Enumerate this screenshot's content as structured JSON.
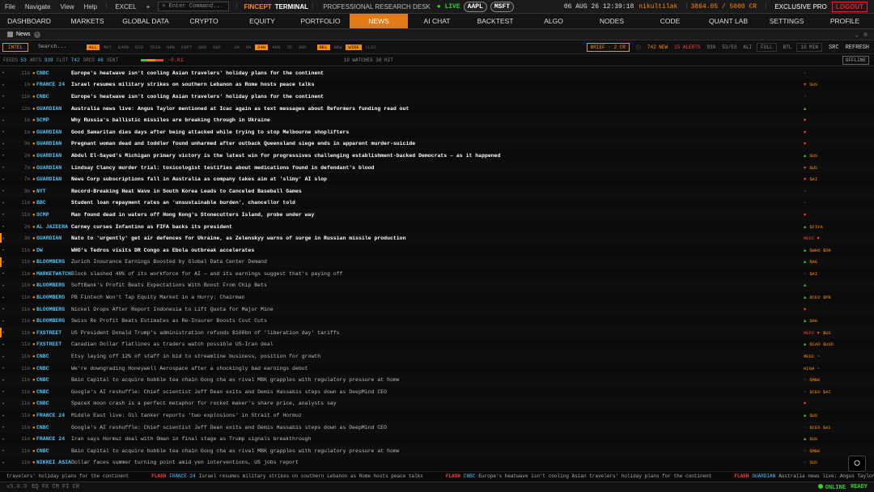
{
  "menu": {
    "items": [
      "File",
      "Navigate",
      "View",
      "Help"
    ],
    "excel": "EXCEL",
    "plus": "+",
    "command_placeholder": "> Enter Command..."
  },
  "brand": {
    "part1": "FINCEPT",
    "part2": "TERMINAL",
    "desk": "PROFESSIONAL RESEARCH DESK"
  },
  "status": {
    "live": "LIVE",
    "tickers": [
      "AAPL",
      "MSFT"
    ],
    "datetime": "06 AUG 26 12:39:18",
    "user": "nikultilak",
    "credits": "3864.05 / 5000 CR",
    "plan": "EXCLUSIVE PRO",
    "logout": "LOGOUT"
  },
  "nav": [
    "DASHBOARD",
    "MARKETS",
    "GLOBAL DATA",
    "CRYPTO",
    "EQUITY",
    "PORTFOLIO",
    "NEWS",
    "AI CHAT",
    "BACKTEST",
    "ALGO",
    "NODES",
    "CODE",
    "QUANT LAB",
    "SETTINGS",
    "PROFILE"
  ],
  "nav_active": "NEWS",
  "subtab": {
    "name": "News",
    "close": "×"
  },
  "filters": {
    "intel": "INTEL",
    "search_placeholder": "Search...",
    "categories": [
      "ALL",
      "MKT",
      "EARN",
      "ECO",
      "TECH",
      "NRG",
      "CRPT",
      "GEO",
      "DEF"
    ],
    "active_category": "ALL",
    "times": [
      "1H",
      "6H",
      "24H",
      "48H",
      "7D",
      "30D"
    ],
    "active_time": "24H",
    "sorts": [
      "REL",
      "NEW",
      "WIRE",
      "CLST"
    ],
    "active_sorts": [
      "REL",
      "WIRE"
    ],
    "brief": "BRIEF · 2 CR",
    "new_count": "742 NEW",
    "alerts": "15 ALERTS",
    "count": "939",
    "ratio": "53/53",
    "ali": "ALI",
    "full": "FULL",
    "btl": "BTL",
    "interval": "10 MIN",
    "src": "SRC",
    "refresh": "REFRESH"
  },
  "stats": {
    "feeds_label": "FEEDS",
    "feeds": "53",
    "arts_label": "ARTS",
    "arts": "939",
    "clst_label": "CLST",
    "clst": "742",
    "srcs_label": "SRCS",
    "srcs": "48",
    "sent_label": "SENT",
    "sentiment": "-0.01",
    "watches": "10 WATCHES",
    "hit": "38 HIT",
    "offline": "OFFLINE"
  },
  "colors": {
    "accent": "#ff8c00",
    "source": "#4fc3f7",
    "up": "#2fd12f",
    "down": "#ff3b3b"
  },
  "news": [
    {
      "age": "11m",
      "src": "CNBC",
      "headline": "Europe's heatwave isn't cooling Asian travelers' holiday plans for the continent",
      "bold": true,
      "sig": "~",
      "tags": "",
      "bar": ""
    },
    {
      "age": "1m",
      "src": "FRANCE 24",
      "headline": "Israel resumes military strikes on southern Lebanon as Rome hosts peace talks",
      "bold": true,
      "sig": "▼",
      "tags": "$US",
      "bar": ""
    },
    {
      "age": "11m",
      "src": "CNBC",
      "headline": "Europe's heatwave isn't cooling Asian travelers' holiday plans for the continent",
      "bold": true,
      "sig": "~",
      "tags": "",
      "bar": ""
    },
    {
      "age": "12m",
      "src": "GUARDIAN",
      "headline": "Australia news live: Angus Taylor mentioned at Icac again as text messages about Reformers funding read out",
      "bold": true,
      "sig": "▲",
      "tags": "",
      "bar": ""
    },
    {
      "age": "1m",
      "src": "SCMP",
      "headline": "Why Russia's ballistic missiles are breaking through in Ukraine",
      "bold": true,
      "sig": "▼",
      "tags": "",
      "bar": ""
    },
    {
      "age": "1m",
      "src": "GUARDIAN",
      "headline": "Good Samaritan dies days after being attacked while trying to stop Melbourne shoplifters",
      "bold": true,
      "sig": "▼",
      "tags": "",
      "bar": ""
    },
    {
      "age": "9m",
      "src": "GUARDIAN",
      "headline": "Pregnant woman dead and toddler found unharmed after outback Queensland siege ends in apparent murder-suicide",
      "bold": true,
      "sig": "▼",
      "tags": "",
      "bar": ""
    },
    {
      "age": "2m",
      "src": "GUARDIAN",
      "headline": "Abdul El-Sayed's Michigan primary victory is the latest win for progressives challenging establishment-backed Democrats – as it happened",
      "bold": true,
      "sig": "▲",
      "tags": "$US",
      "bar": ""
    },
    {
      "age": "7m",
      "src": "GUARDIAN",
      "headline": "Lindsay Clancy murder trial: toxicologist testifies about medications found in defendant's blood",
      "bold": true,
      "sig": "▼",
      "tags": "$US",
      "bar": ""
    },
    {
      "age": "7m",
      "src": "GUARDIAN",
      "headline": "News Corp subscriptions fall in Australia as company takes aim at 'slimy' AI slop",
      "bold": true,
      "sig": "▼",
      "tags": "$AI",
      "bar": ""
    },
    {
      "age": "9m",
      "src": "NYT",
      "headline": "Record-Breaking Heat Wave in South Korea Leads to Canceled Baseball Games",
      "bold": true,
      "sig": "~",
      "tags": "",
      "bar": ""
    },
    {
      "age": "11m",
      "src": "BBC",
      "headline": "Student loan repayment rates an 'unsustainable burden', chancellor told",
      "bold": true,
      "sig": "~",
      "tags": "",
      "bar": ""
    },
    {
      "age": "11m",
      "src": "SCMP",
      "headline": "Man found dead in waters off Hong Kong's Stonecutters Island, probe under way",
      "bold": true,
      "sig": "▼",
      "tags": "",
      "bar": ""
    },
    {
      "age": "2m",
      "src": "AL JAZEERA",
      "headline": "Carney curses Infantino as FIFA backs its president",
      "bold": true,
      "sig": "▲",
      "tags": "$FIFA",
      "bar": ""
    },
    {
      "age": "3m",
      "src": "GUARDIAN",
      "headline": "Nato to 'urgently' get air defences for Ukraine, as Zelenskyy warns of surge in Russian missile production",
      "bold": true,
      "sig": "MEDI ▼",
      "tags": "",
      "bar": "#ff8c00"
    },
    {
      "age": "11m",
      "src": "DW",
      "headline": "WHO's Tedros visits DR Congo as Ebola outbreak accelerates",
      "bold": true,
      "sig": "▲",
      "tags": "$WHO $DR",
      "bar": ""
    },
    {
      "age": "11m",
      "src": "BLOOMBERG",
      "headline": "Zurich Insurance Earnings Boosted by Global Data Center Demand",
      "bold": false,
      "sig": "▲",
      "tags": "$AG",
      "bar": "#ff8c00"
    },
    {
      "age": "11m",
      "src": "MARKETWATCH",
      "headline": "Block slashed 40% of its workforce for AI — and its earnings suggest that's paying off",
      "bold": false,
      "sig": "~",
      "tags": "$AI",
      "bar": ""
    },
    {
      "age": "11m",
      "src": "BLOOMBERG",
      "headline": "SoftBank's Profit Beats Expectations With Boost From Chip Bets",
      "bold": false,
      "sig": "▲",
      "tags": "",
      "bar": ""
    },
    {
      "age": "11m",
      "src": "BLOOMBERG",
      "headline": "PB Fintech Won't Tap Equity Market in a Hurry: Chairman",
      "bold": false,
      "sig": "▲",
      "tags": "$CEO $PB",
      "bar": ""
    },
    {
      "age": "11m",
      "src": "BLOOMBERG",
      "headline": "Nickel Drops After Report Indonesia to Lift Quota for Major Mine",
      "bold": false,
      "sig": "▼",
      "tags": "",
      "bar": ""
    },
    {
      "age": "11m",
      "src": "BLOOMBERG",
      "headline": "Swiss Re Profit Beats Estimates as Re-Insurer Boosts Cost Cuts",
      "bold": false,
      "sig": "▲",
      "tags": "$AG",
      "bar": ""
    },
    {
      "age": "11m",
      "src": "FXSTREET",
      "headline": "US President Donald Trump's administration refunds $100bn of 'liberation day' tariffs",
      "bold": false,
      "sig": "MEDI ▼",
      "tags": "$US",
      "bar": "#ff8c00"
    },
    {
      "age": "11m",
      "src": "FXSTREET",
      "headline": "Canadian Dollar flatlines as traders watch possible US-Iran deal",
      "bold": false,
      "sig": "▲",
      "tags": "$CAD $USD",
      "bar": ""
    },
    {
      "age": "11m",
      "src": "CNBC",
      "headline": "Etsy laying off 12% of staff in bid to streamline business, position for growth",
      "bold": false,
      "sig": "MEDI ~",
      "tags": "",
      "bar": ""
    },
    {
      "age": "11m",
      "src": "CNBC",
      "headline": "We're downgrading Honeywell Aerospace after a shockingly bad earnings debut",
      "bold": false,
      "sig": "HIGH ~",
      "tags": "",
      "bar": ""
    },
    {
      "age": "11m",
      "src": "CNBC",
      "headline": "Bain Capital to acquire bubble tea chain Gong cha as rival MBK grapples with regulatory pressure at home",
      "bold": false,
      "sig": "~",
      "tags": "$MBK",
      "bar": ""
    },
    {
      "age": "11m",
      "src": "CNBC",
      "headline": "Google's AI reshuffle: Chief scientist Jeff Dean exits and Demis Hassabis steps down as DeepMind CEO",
      "bold": false,
      "sig": "~",
      "tags": "$CEO $AI",
      "bar": ""
    },
    {
      "age": "11m",
      "src": "CNBC",
      "headline": "SpaceX moon crash is a perfect metaphor for rocket maker's share price, analysts say",
      "bold": false,
      "sig": "▼",
      "tags": "",
      "bar": ""
    },
    {
      "age": "11m",
      "src": "FRANCE 24",
      "headline": "Middle East live: Oil tanker reports 'two explosions' in Strait of Hormuz",
      "bold": false,
      "sig": "▲",
      "tags": "$US",
      "bar": ""
    },
    {
      "age": "11m",
      "src": "CNBC",
      "headline": "Google's AI reshuffle: Chief scientist Jeff Dean exits and Demis Hassabis steps down as DeepMind CEO",
      "bold": false,
      "sig": "~",
      "tags": "$CEO $AI",
      "bar": ""
    },
    {
      "age": "11m",
      "src": "FRANCE 24",
      "headline": "Iran says Hormuz deal with Oman in final stage as Trump signals breakthrough",
      "bold": false,
      "sig": "▲",
      "tags": "$US",
      "bar": ""
    },
    {
      "age": "11m",
      "src": "CNBC",
      "headline": "Bain Capital to acquire bubble tea chain Gong cha as rival MBK grapples with regulatory pressure at home",
      "bold": false,
      "sig": "~",
      "tags": "$MBK",
      "bar": ""
    },
    {
      "age": "11m",
      "src": "NIKKEI ASIA",
      "headline": "Dollar faces summer turning point amid yen interventions, US jobs report",
      "bold": false,
      "sig": "~",
      "tags": "$US",
      "bar": ""
    }
  ],
  "ticker": [
    {
      "flash": "",
      "src": "",
      "text": "travelers' holiday plans for the continent"
    },
    {
      "flash": "FLASH",
      "src": "FRANCE 24",
      "text": "Israel resumes military strikes on southern Lebanon as Rome hosts peace talks"
    },
    {
      "flash": "FLASH",
      "src": "CNBC",
      "text": "Europe's heatwave isn't cooling Asian travelers' holiday plans for the continent"
    },
    {
      "flash": "FLASH",
      "src": "GUARDIAN",
      "text": "Australia news live: Angus Taylor mentioned at Icac again"
    }
  ],
  "footer": {
    "version": "v5.0.0",
    "markets": "EQ FX CM FI CR",
    "online": "ONLINE",
    "ready": "READY"
  }
}
